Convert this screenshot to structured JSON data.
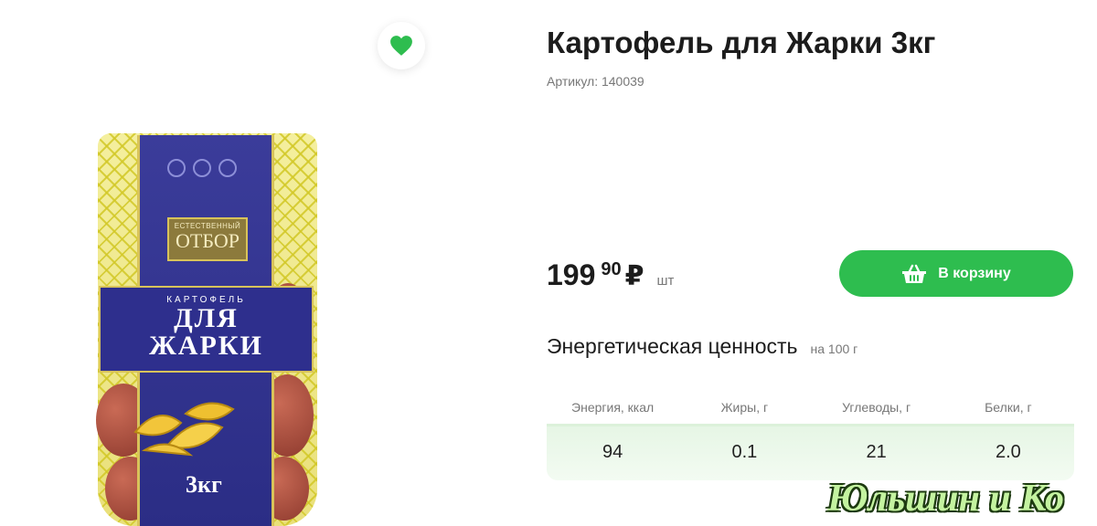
{
  "product": {
    "title": "Картофель для Жарки 3кг",
    "sku": "Артикул: 140039",
    "image": {
      "brand_line1": "ЕСТЕСТВЕННЫЙ",
      "brand_line2": "ОТБОР",
      "pack_small": "КАРТОФЕЛЬ",
      "pack_line1": "ДЛЯ",
      "pack_line2": "ЖАРКИ",
      "pack_weight": "3кг"
    },
    "favorite_icon": "heart-icon",
    "favorite_color": "#2ebd4f"
  },
  "price": {
    "integer": "199",
    "fraction": "90",
    "currency": "₽",
    "unit": "шт"
  },
  "cart_button": {
    "label": "В корзину",
    "icon": "basket-icon",
    "color": "#2ebd4f"
  },
  "energy": {
    "title": "Энергетическая ценность",
    "per": "на 100 г",
    "columns": [
      "Энергия, ккал",
      "Жиры, г",
      "Углеводы, г",
      "Белки, г"
    ],
    "values": [
      "94",
      "0.1",
      "21",
      "2.0"
    ]
  },
  "watermark": "Юльшин и Ко"
}
